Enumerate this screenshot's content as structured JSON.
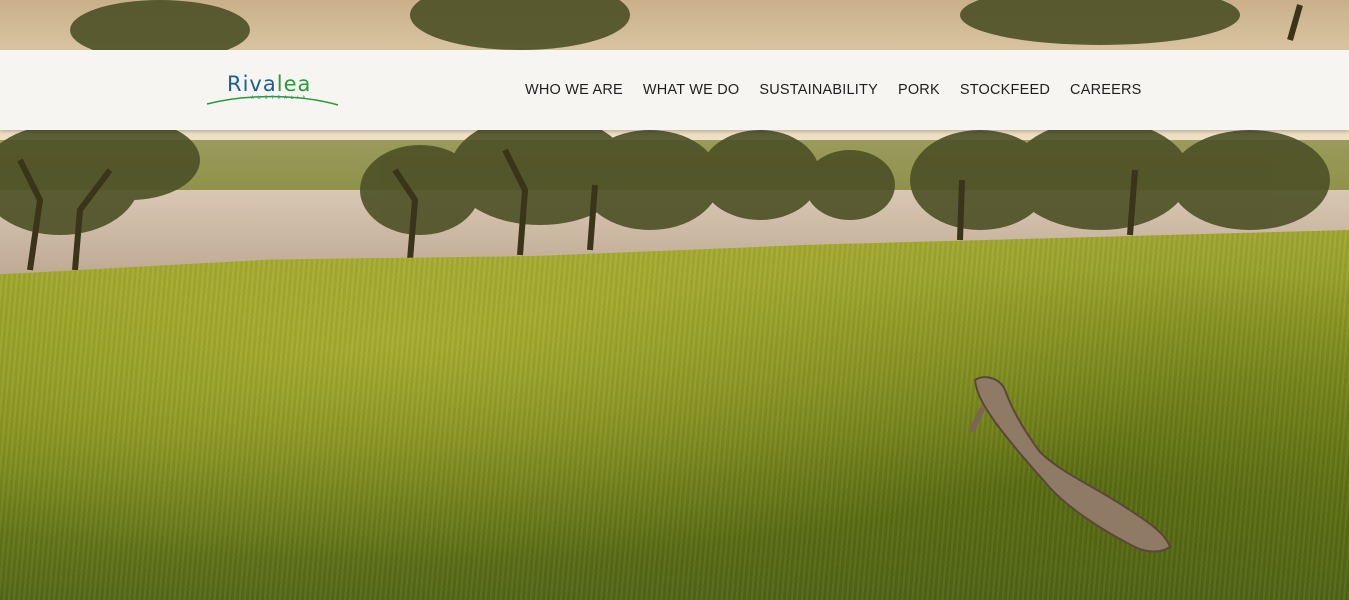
{
  "brand": {
    "name_prefix": "Riva",
    "name_suffix": "lea",
    "tagline": "AUSTRALIA",
    "colors": {
      "blue": "#1b5d96",
      "green": "#2a9a3c"
    }
  },
  "nav": {
    "items": [
      {
        "label": "WHO WE ARE"
      },
      {
        "label": "WHAT WE DO"
      },
      {
        "label": "SUSTAINABILITY"
      },
      {
        "label": "PORK"
      },
      {
        "label": "STOCKFEED"
      },
      {
        "label": "CAREERS"
      }
    ]
  },
  "hero": {
    "scene": "green-paddock-with-lake-and-gum-trees"
  }
}
